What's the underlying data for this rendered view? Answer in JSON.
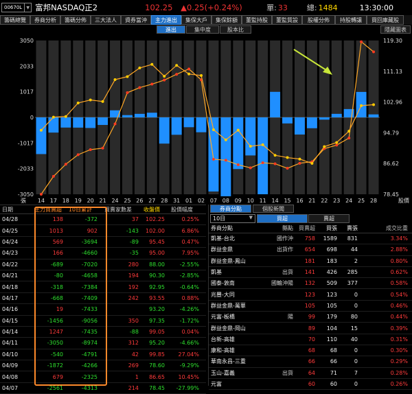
{
  "header": {
    "code": "00670L",
    "name": "富邦NASDAQ正2",
    "price": "102.25",
    "change": "▲0.25(+0.24%)",
    "lots_label": "單:",
    "lots": "33",
    "volume_label": "總:",
    "volume": "1484",
    "time": "13:30:00"
  },
  "tabs": [
    "籌碼總覽",
    "券商分析",
    "籌碼分佈",
    "三大法人",
    "資券當沖",
    "主力進出",
    "集保大戶",
    "集保餘額",
    "董監持股",
    "董監質設",
    "股權分佈",
    "持股轉讓",
    "買回庫藏股"
  ],
  "active_tab": 5,
  "subtabs": [
    "進出",
    "集中度",
    "股本比"
  ],
  "hide_chart_label": "隱藏圖表",
  "colors": {
    "bar": "#1f8fff",
    "line": "#ffa726",
    "marker": "#ffcc00",
    "up": "#ff3b3b",
    "down": "#2ee02e",
    "arrow": "#c8e639"
  },
  "chart_data": {
    "type": "bar",
    "categories": [
      "14",
      "17",
      "18",
      "19",
      "20",
      "21",
      "24",
      "25",
      "26",
      "27",
      "28",
      "31",
      "01",
      "02",
      "07",
      "08",
      "09",
      "10",
      "11",
      "14",
      "15",
      "16",
      "21",
      "22",
      "23",
      "24",
      "25",
      "28"
    ],
    "bar_series": {
      "name": "主力買賣超",
      "values": [
        -1456,
        -603,
        -404,
        -406,
        -420,
        -300,
        280,
        90,
        140,
        185,
        -1040,
        -690,
        -390,
        -590,
        -2940,
        -3130,
        -2050,
        -1510,
        -3050,
        1013,
        -240,
        -680,
        -430,
        -90,
        140,
        330,
        1010,
        118
      ]
    },
    "net_line": {
      "name": "10日累計",
      "values": [
        -3050,
        -2340,
        -1860,
        -1480,
        -1280,
        -1220,
        -260,
        980,
        1180,
        1320,
        1480,
        1710,
        1920,
        1490,
        -1660,
        -1700,
        -1880,
        -2000,
        -1800,
        -1840,
        -2020,
        -1820,
        -1760,
        -1240,
        -1100,
        -820,
        3000,
        2600
      ]
    },
    "price_line": {
      "name": "收盤價",
      "values": [
        95.45,
        98.95,
        99.1,
        102.7,
        103.5,
        103.1,
        108.9,
        109.7,
        112.0,
        112.96,
        109.8,
        112.7,
        110.4,
        110.0,
        95.6,
        92.9,
        95.47,
        91.2,
        91.6,
        88.8,
        88.2,
        87.8,
        86.65,
        91.1,
        92.2,
        95.2,
        102.0,
        102.25
      ]
    },
    "y_left": {
      "min": -3050,
      "max": 3050,
      "ticks": [
        "3050",
        "2033",
        "1017",
        "0",
        "-1017",
        "-2033",
        "-3050"
      ]
    },
    "y_right": {
      "min": 78.45,
      "max": 119.3,
      "ticks": [
        "119.30",
        "111.13",
        "102.96",
        "94.79",
        "86.62",
        "78.45"
      ]
    },
    "x_start_label": "張",
    "x_end_label": "股價",
    "title": "",
    "xlabel": "",
    "ylabel": ""
  },
  "table": {
    "headers": [
      "日期",
      "主力買賣超",
      "10日累計",
      "買賣家數差",
      "收盤價",
      "股價幅度"
    ],
    "rows": [
      [
        "04/28",
        "138",
        "-372",
        "37",
        "102.25",
        "0.25%"
      ],
      [
        "04/25",
        "1013",
        "902",
        "-143",
        "102.00",
        "6.86%"
      ],
      [
        "04/24",
        "569",
        "-3694",
        "-89",
        "95.45",
        "0.47%"
      ],
      [
        "04/23",
        "166",
        "-4660",
        "-35",
        "95.00",
        "7.95%"
      ],
      [
        "04/22",
        "-689",
        "-7020",
        "280",
        "88.00",
        "-2.55%"
      ],
      [
        "04/21",
        "-80",
        "-4658",
        "194",
        "90.30",
        "-2.85%"
      ],
      [
        "04/18",
        "-318",
        "-7384",
        "192",
        "92.95",
        "-0.64%"
      ],
      [
        "04/17",
        "-668",
        "-7409",
        "242",
        "93.55",
        "0.88%"
      ],
      [
        "04/16",
        "19",
        "-7433",
        "",
        "93.20",
        "-4.26%"
      ],
      [
        "04/15",
        "-1456",
        "-9056",
        "350",
        "97.35",
        "-1.72%"
      ],
      [
        "04/14",
        "1247",
        "-7435",
        "-88",
        "99.05",
        "0.04%"
      ],
      [
        "04/11",
        "-3050",
        "-8974",
        "312",
        "95.20",
        "-4.66%"
      ],
      [
        "04/10",
        "-540",
        "-4791",
        "42",
        "99.85",
        "27.04%"
      ],
      [
        "04/09",
        "-1872",
        "-4266",
        "269",
        "78.60",
        "-9.29%"
      ],
      [
        "04/08",
        "679",
        "-2325",
        "1",
        "86.65",
        "10.45%"
      ],
      [
        "04/07",
        "-2561",
        "-4313",
        "214",
        "78.45",
        "-27.99%"
      ]
    ]
  },
  "brokers": {
    "tabs": [
      "券商分點",
      "個股新聞"
    ],
    "period": "10日",
    "buy_label": "買超",
    "sell_label": "賣超",
    "headers": [
      "券商分點",
      "縣點",
      "買賣超",
      "買張",
      "賣張",
      "成交比重"
    ],
    "rows": [
      [
        "凱基-台北",
        "國作沖",
        "758",
        "1589",
        "831",
        "3.34%"
      ],
      [
        "群益金鼎",
        "出貨作",
        "654",
        "698",
        "44",
        "2.88%"
      ],
      [
        "群益金鼎-鳳山",
        "",
        "181",
        "183",
        "2",
        "0.80%"
      ],
      [
        "凱基",
        "出貨",
        "141",
        "426",
        "285",
        "0.62%"
      ],
      [
        "國泰-敦南",
        "國輪沖陽",
        "132",
        "509",
        "377",
        "0.58%"
      ],
      [
        "兆豐-大同",
        "",
        "123",
        "123",
        "0",
        "0.54%"
      ],
      [
        "群益金鼎-萬華",
        "",
        "105",
        "105",
        "0",
        "0.46%"
      ],
      [
        "元富-板橋",
        "陽",
        "99",
        "179",
        "80",
        "0.44%"
      ],
      [
        "群益金鼎-岡山",
        "",
        "89",
        "104",
        "15",
        "0.39%"
      ],
      [
        "台新-高雄",
        "",
        "70",
        "110",
        "40",
        "0.31%"
      ],
      [
        "康和-高雄",
        "",
        "68",
        "68",
        "0",
        "0.30%"
      ],
      [
        "華南永昌-三重",
        "",
        "66",
        "66",
        "0",
        "0.29%"
      ],
      [
        "玉山-嘉義",
        "出貨",
        "64",
        "71",
        "7",
        "0.28%"
      ],
      [
        "元富",
        "",
        "60",
        "60",
        "0",
        "0.26%"
      ]
    ]
  }
}
